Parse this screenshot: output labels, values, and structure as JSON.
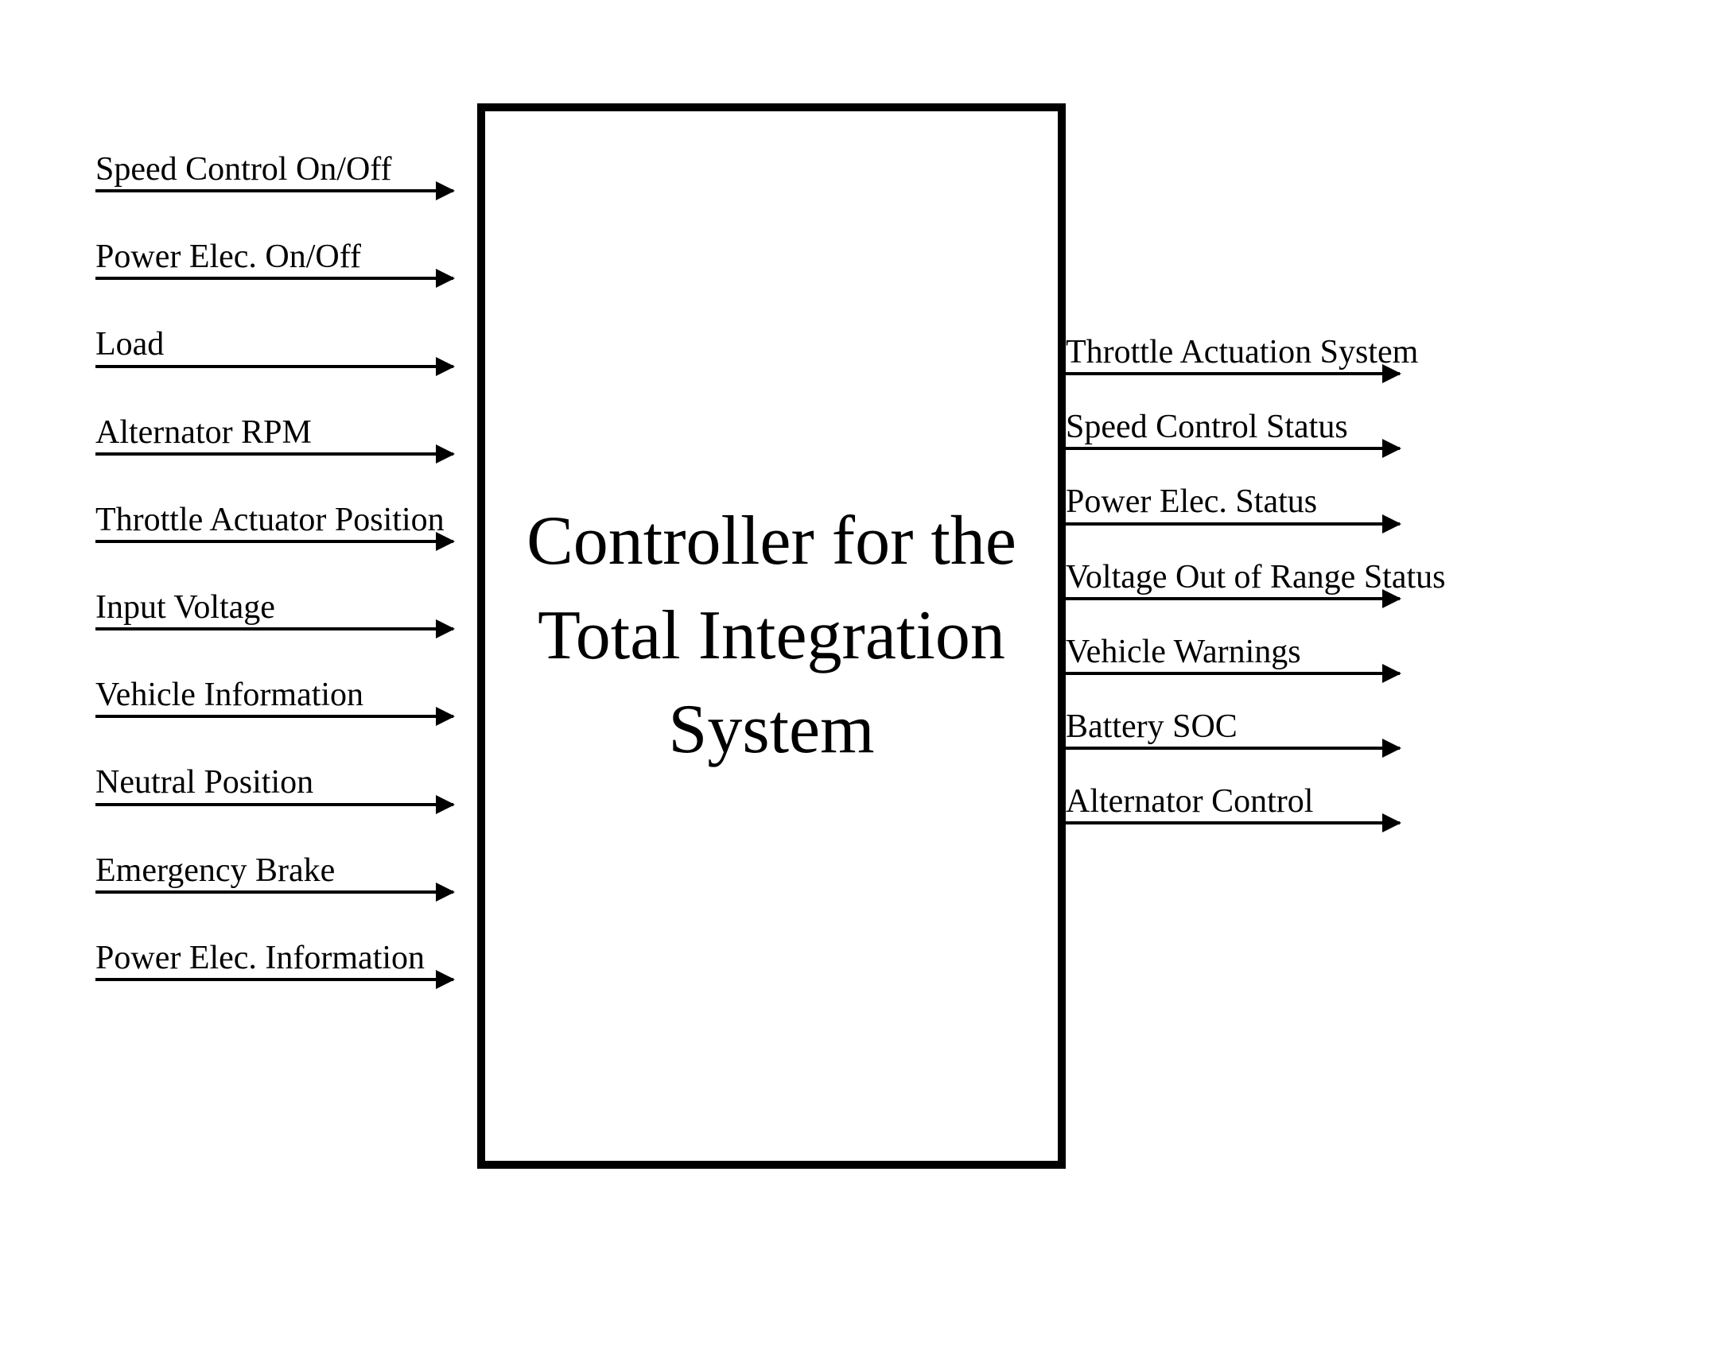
{
  "center": {
    "title": "Controller for the Total Integration System"
  },
  "inputs": [
    "Speed Control On/Off",
    "Power Elec. On/Off",
    "Load",
    "Alternator RPM",
    "Throttle Actuator Position",
    "Input Voltage",
    "Vehicle Information",
    "Neutral Position",
    "Emergency Brake",
    "Power Elec. Information"
  ],
  "outputs": [
    "Throttle Actuation System",
    "Speed Control Status",
    "Power Elec. Status",
    "Voltage Out of Range Status",
    "Vehicle Warnings",
    "Battery SOC",
    "Alternator Control"
  ]
}
